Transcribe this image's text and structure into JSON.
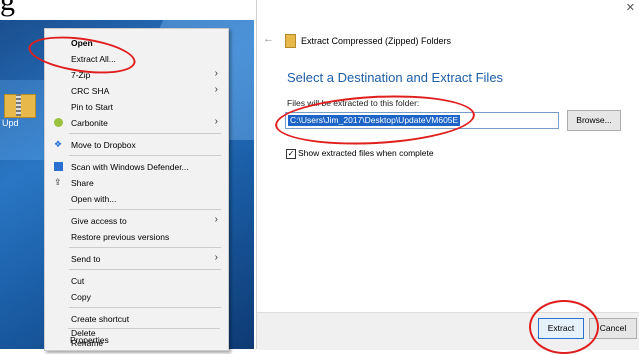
{
  "top_text": "g",
  "desktop": {
    "folder_label": "Upd"
  },
  "context_menu": {
    "items": [
      {
        "label": "Open"
      },
      {
        "label": "Extract All..."
      },
      {
        "label": "7-Zip"
      },
      {
        "label": "CRC SHA"
      },
      {
        "label": "Pin to Start"
      },
      {
        "label": "Carbonite"
      },
      {
        "label": "Move to Dropbox"
      },
      {
        "label": "Scan with Windows Defender..."
      },
      {
        "label": "Share"
      },
      {
        "label": "Open with..."
      },
      {
        "label": "Give access to"
      },
      {
        "label": "Restore previous versions"
      },
      {
        "label": "Send to"
      },
      {
        "label": "Cut"
      },
      {
        "label": "Copy"
      },
      {
        "label": "Create shortcut"
      },
      {
        "label": "Delete"
      },
      {
        "label": "Rename"
      },
      {
        "label": "Properties"
      }
    ]
  },
  "dialog": {
    "title": "Extract Compressed (Zipped) Folders",
    "heading": "Select a Destination and Extract Files",
    "dest_label": "Files will be extracted to this folder:",
    "dest_value": "C:\\Users\\Jim_2017\\Desktop\\UpdateVM605E",
    "browse_label": "Browse...",
    "show_files_label": "Show extracted files when complete",
    "show_files_checked": true,
    "extract_label": "Extract",
    "cancel_label": "Cancel"
  },
  "colors": {
    "accent": "#1d5fa8",
    "annotation": "#e01e1e",
    "selection": "#1c64c8"
  }
}
